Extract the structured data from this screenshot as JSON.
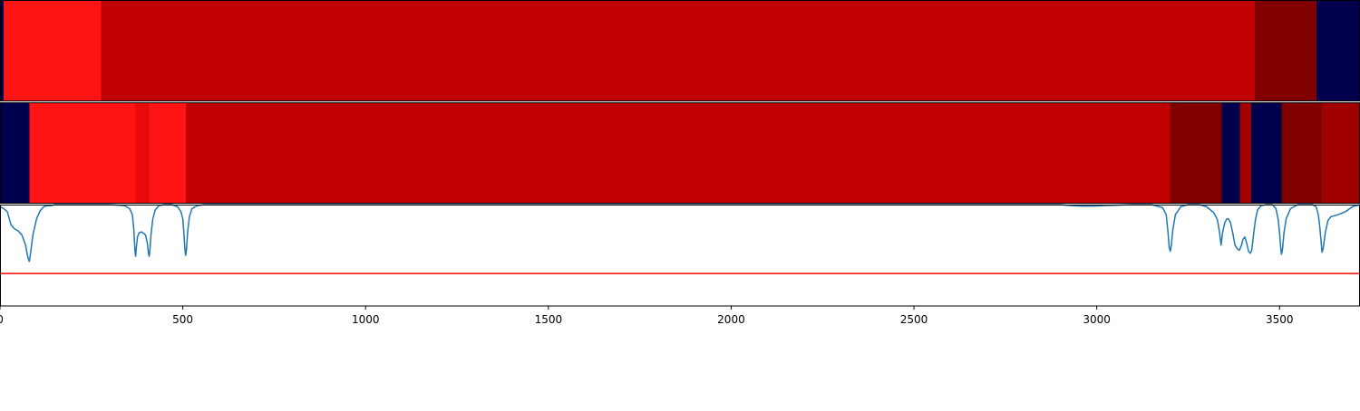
{
  "chart_data": {
    "type": "heatmap",
    "title": "",
    "xlabel": "",
    "ylabel": "",
    "xlim": [
      0,
      3720
    ],
    "grid": false,
    "legend": "none",
    "x_ticks": [
      0,
      500,
      1000,
      1500,
      2000,
      2500,
      3000,
      3500
    ],
    "x_tick_labels": [
      "0",
      "500",
      "1000",
      "1500",
      "2000",
      "2500",
      "3000",
      "3500"
    ],
    "bands": [
      {
        "segments": [
          {
            "x0": 0,
            "x1": 10,
            "color": "#00004d"
          },
          {
            "x0": 10,
            "x1": 277,
            "color": "#ff1414"
          },
          {
            "x0": 277,
            "x1": 3432,
            "color": "#c00000"
          },
          {
            "x0": 3432,
            "x1": 3601,
            "color": "#800000"
          },
          {
            "x0": 3601,
            "x1": 3720,
            "color": "#00004d"
          }
        ]
      },
      {
        "segments": [
          {
            "x0": 0,
            "x1": 80,
            "color": "#00004d"
          },
          {
            "x0": 80,
            "x1": 371,
            "color": "#ff1414"
          },
          {
            "x0": 371,
            "x1": 408,
            "color": "#e80a0a"
          },
          {
            "x0": 408,
            "x1": 508,
            "color": "#ff1414"
          },
          {
            "x0": 508,
            "x1": 3201,
            "color": "#c00000"
          },
          {
            "x0": 3201,
            "x1": 3342,
            "color": "#800000"
          },
          {
            "x0": 3342,
            "x1": 3392,
            "color": "#00004d"
          },
          {
            "x0": 3392,
            "x1": 3422,
            "color": "#a00000"
          },
          {
            "x0": 3422,
            "x1": 3505,
            "color": "#00004d"
          },
          {
            "x0": 3505,
            "x1": 3616,
            "color": "#800000"
          },
          {
            "x0": 3616,
            "x1": 3720,
            "color": "#a00000"
          }
        ]
      }
    ],
    "line_series": {
      "color": "#1f77b4",
      "ylim": [
        0,
        1
      ],
      "x": [
        0,
        10,
        20,
        30,
        40,
        50,
        60,
        70,
        75,
        78,
        80,
        82,
        85,
        90,
        100,
        110,
        120,
        130,
        140,
        150,
        200,
        250,
        300,
        340,
        355,
        362,
        366,
        369,
        371,
        373,
        376,
        380,
        386,
        392,
        398,
        403,
        406,
        408,
        410,
        413,
        418,
        425,
        435,
        450,
        470,
        485,
        495,
        500,
        503,
        505,
        507,
        508,
        510,
        513,
        518,
        525,
        540,
        560,
        600,
        1000,
        1500,
        2000,
        2500,
        2900,
        2930,
        2960,
        2990,
        3020,
        3100,
        3150,
        3180,
        3190,
        3195,
        3198,
        3201,
        3204,
        3208,
        3215,
        3230,
        3250,
        3280,
        3300,
        3320,
        3330,
        3336,
        3340,
        3344,
        3350,
        3356,
        3360,
        3366,
        3372,
        3378,
        3385,
        3390,
        3396,
        3400,
        3405,
        3410,
        3415,
        3420,
        3424,
        3428,
        3434,
        3440,
        3450,
        3465,
        3480,
        3490,
        3496,
        3500,
        3503,
        3505,
        3508,
        3512,
        3518,
        3530,
        3550,
        3570,
        3590,
        3600,
        3606,
        3610,
        3614,
        3616,
        3619,
        3625,
        3632,
        3640,
        3650,
        3660,
        3680,
        3700,
        3720
      ],
      "y": [
        0.98,
        0.96,
        0.93,
        0.8,
        0.76,
        0.74,
        0.7,
        0.6,
        0.5,
        0.46,
        0.44,
        0.48,
        0.56,
        0.7,
        0.86,
        0.94,
        0.98,
        0.99,
        0.99,
        1.0,
        1.0,
        1.0,
        1.0,
        0.99,
        0.96,
        0.9,
        0.76,
        0.55,
        0.49,
        0.58,
        0.68,
        0.72,
        0.73,
        0.72,
        0.7,
        0.62,
        0.52,
        0.49,
        0.55,
        0.7,
        0.86,
        0.95,
        0.99,
        1.0,
        1.0,
        0.98,
        0.93,
        0.86,
        0.72,
        0.6,
        0.52,
        0.5,
        0.56,
        0.72,
        0.88,
        0.96,
        0.99,
        1.0,
        1.0,
        1.0,
        1.0,
        1.0,
        1.0,
        1.0,
        0.99,
        0.985,
        0.985,
        0.99,
        1.0,
        1.0,
        0.97,
        0.9,
        0.72,
        0.58,
        0.54,
        0.6,
        0.75,
        0.9,
        0.98,
        1.0,
        1.0,
        0.98,
        0.92,
        0.85,
        0.72,
        0.6,
        0.72,
        0.82,
        0.86,
        0.86,
        0.82,
        0.72,
        0.6,
        0.56,
        0.55,
        0.6,
        0.66,
        0.68,
        0.62,
        0.54,
        0.52,
        0.55,
        0.68,
        0.85,
        0.95,
        0.99,
        1.0,
        1.0,
        0.96,
        0.86,
        0.72,
        0.58,
        0.51,
        0.56,
        0.72,
        0.86,
        0.96,
        1.0,
        1.0,
        1.0,
        0.98,
        0.9,
        0.78,
        0.62,
        0.53,
        0.56,
        0.72,
        0.84,
        0.88,
        0.89,
        0.9,
        0.93,
        0.98,
        1.0
      ]
    },
    "threshold": {
      "y": 0.32,
      "color": "#ff0000"
    }
  }
}
